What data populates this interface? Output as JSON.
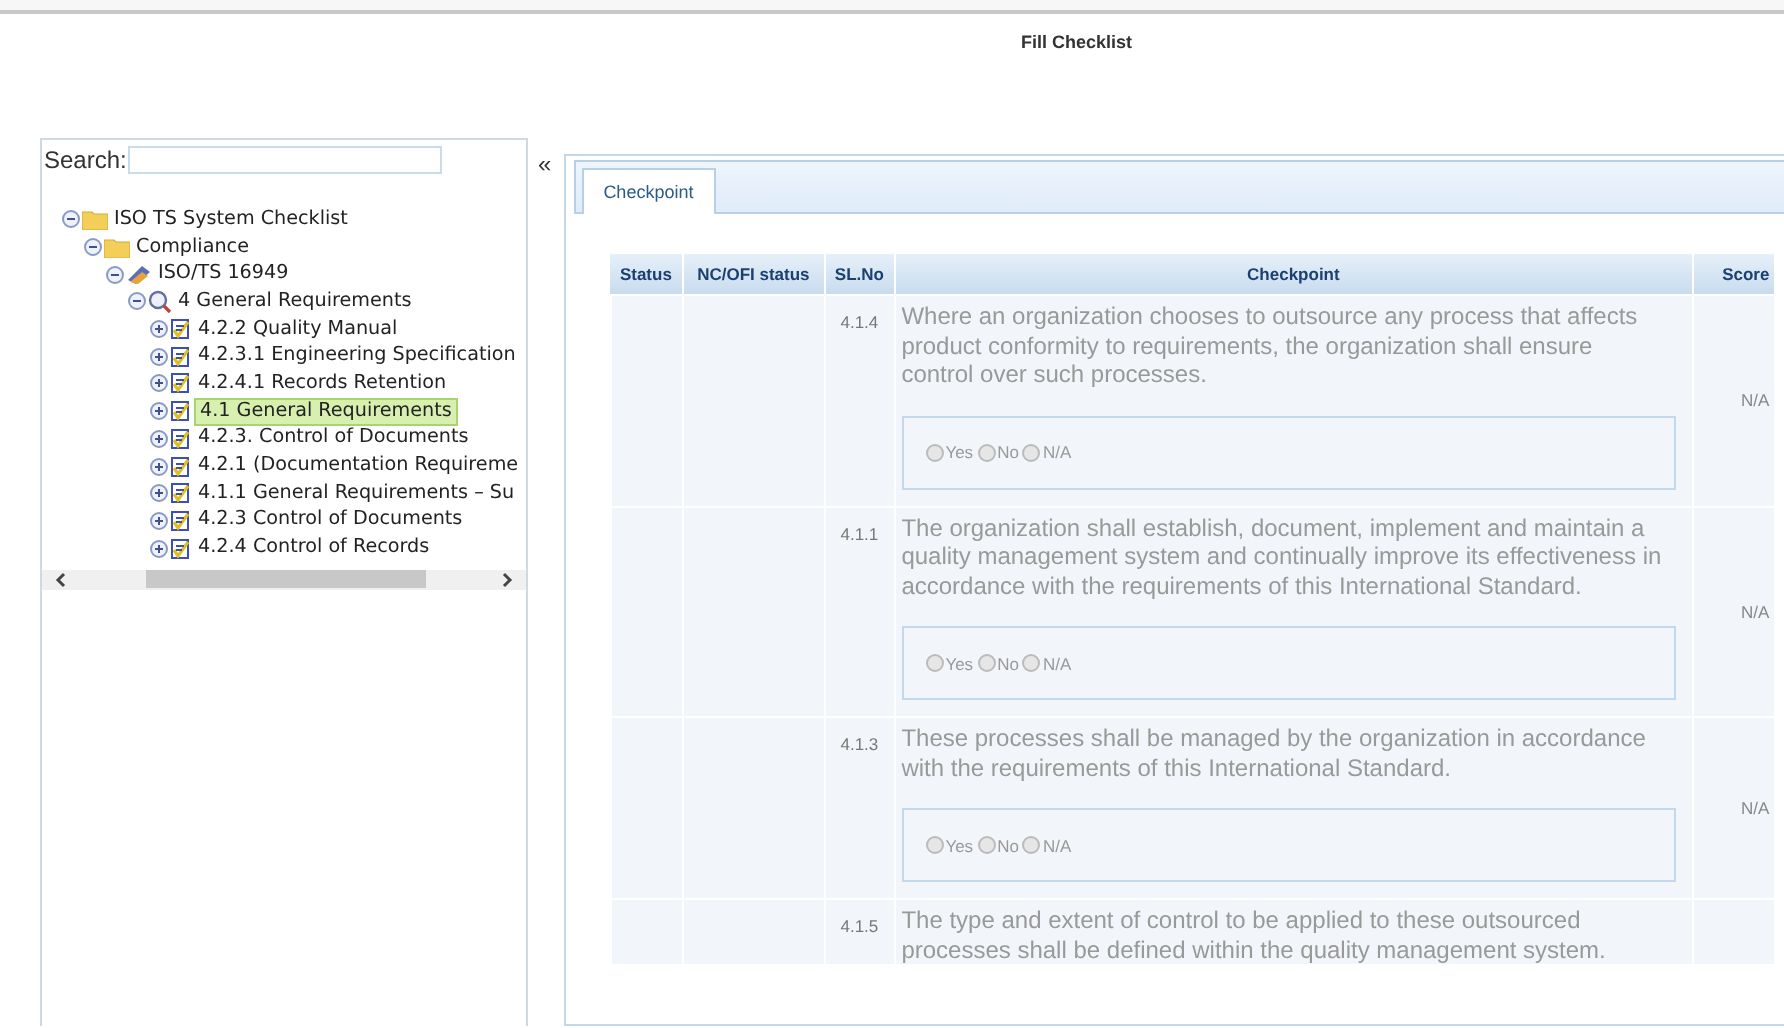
{
  "page_title": "Fill Checklist",
  "sidebar": {
    "search_label": "Search:",
    "collapse_glyph": "«",
    "tree": [
      {
        "label": "ISO TS System Checklist",
        "kind": "folder",
        "expanded": true,
        "selected": false,
        "children": [
          {
            "label": "Compliance",
            "kind": "folder",
            "expanded": true,
            "selected": false,
            "children": [
              {
                "label": "ISO/TS 16949",
                "kind": "standard",
                "expanded": true,
                "selected": false,
                "children": [
                  {
                    "label": "4 General Requirements",
                    "kind": "section",
                    "expanded": true,
                    "selected": false,
                    "children": [
                      {
                        "label": "4.2.2 Quality Manual",
                        "kind": "checklist",
                        "expanded": false,
                        "selected": false
                      },
                      {
                        "label": "4.2.3.1 Engineering Specification",
                        "kind": "checklist",
                        "expanded": false,
                        "selected": false
                      },
                      {
                        "label": "4.2.4.1 Records Retention",
                        "kind": "checklist",
                        "expanded": false,
                        "selected": false
                      },
                      {
                        "label": "4.1 General Requirements",
                        "kind": "checklist",
                        "expanded": false,
                        "selected": true
                      },
                      {
                        "label": "4.2.3. Control of Documents",
                        "kind": "checklist",
                        "expanded": false,
                        "selected": false
                      },
                      {
                        "label": "4.2.1 (Documentation Requireme",
                        "kind": "checklist",
                        "expanded": false,
                        "selected": false
                      },
                      {
                        "label": "4.1.1 General Requirements – Su",
                        "kind": "checklist",
                        "expanded": false,
                        "selected": false
                      },
                      {
                        "label": "4.2.3 Control of Documents",
                        "kind": "checklist",
                        "expanded": false,
                        "selected": false
                      },
                      {
                        "label": "4.2.4 Control of Records",
                        "kind": "checklist",
                        "expanded": false,
                        "selected": false
                      }
                    ]
                  }
                ]
              }
            ]
          }
        ]
      }
    ]
  },
  "tabs": [
    {
      "label": "Checkpoint",
      "selected": true
    }
  ],
  "table": {
    "columns": [
      "Status",
      "NC/OFI status",
      "SL.No",
      "Checkpoint",
      "Score"
    ],
    "rows": [
      {
        "sl_no": "4.1.4",
        "checkpoint": "Where an organization chooses to outsource any process that affects product conformity to requirements, the organization shall ensure control over such processes.",
        "options": [
          {
            "label": "Yes",
            "selected": false
          },
          {
            "label": "No",
            "selected": false
          },
          {
            "label": "N/A",
            "selected": false
          }
        ],
        "score": "N/A"
      },
      {
        "sl_no": "4.1.1",
        "checkpoint": "The organization shall establish, document, implement and maintain a quality management system and continually improve its effectiveness in accordance with the requirements of this International Standard.",
        "options": [
          {
            "label": "Yes",
            "selected": false
          },
          {
            "label": "No",
            "selected": false
          },
          {
            "label": "N/A",
            "selected": false
          }
        ],
        "score": "N/A"
      },
      {
        "sl_no": "4.1.3",
        "checkpoint": "These processes shall be managed by the organization in accordance with the requirements of this International Standard.",
        "options": [
          {
            "label": "Yes",
            "selected": false
          },
          {
            "label": "No",
            "selected": false
          },
          {
            "label": "N/A",
            "selected": false
          }
        ],
        "score": "N/A"
      },
      {
        "sl_no": "4.1.5",
        "checkpoint": "The type and extent of control to be applied to these outsourced processes shall be defined within the quality management system."
      }
    ]
  }
}
